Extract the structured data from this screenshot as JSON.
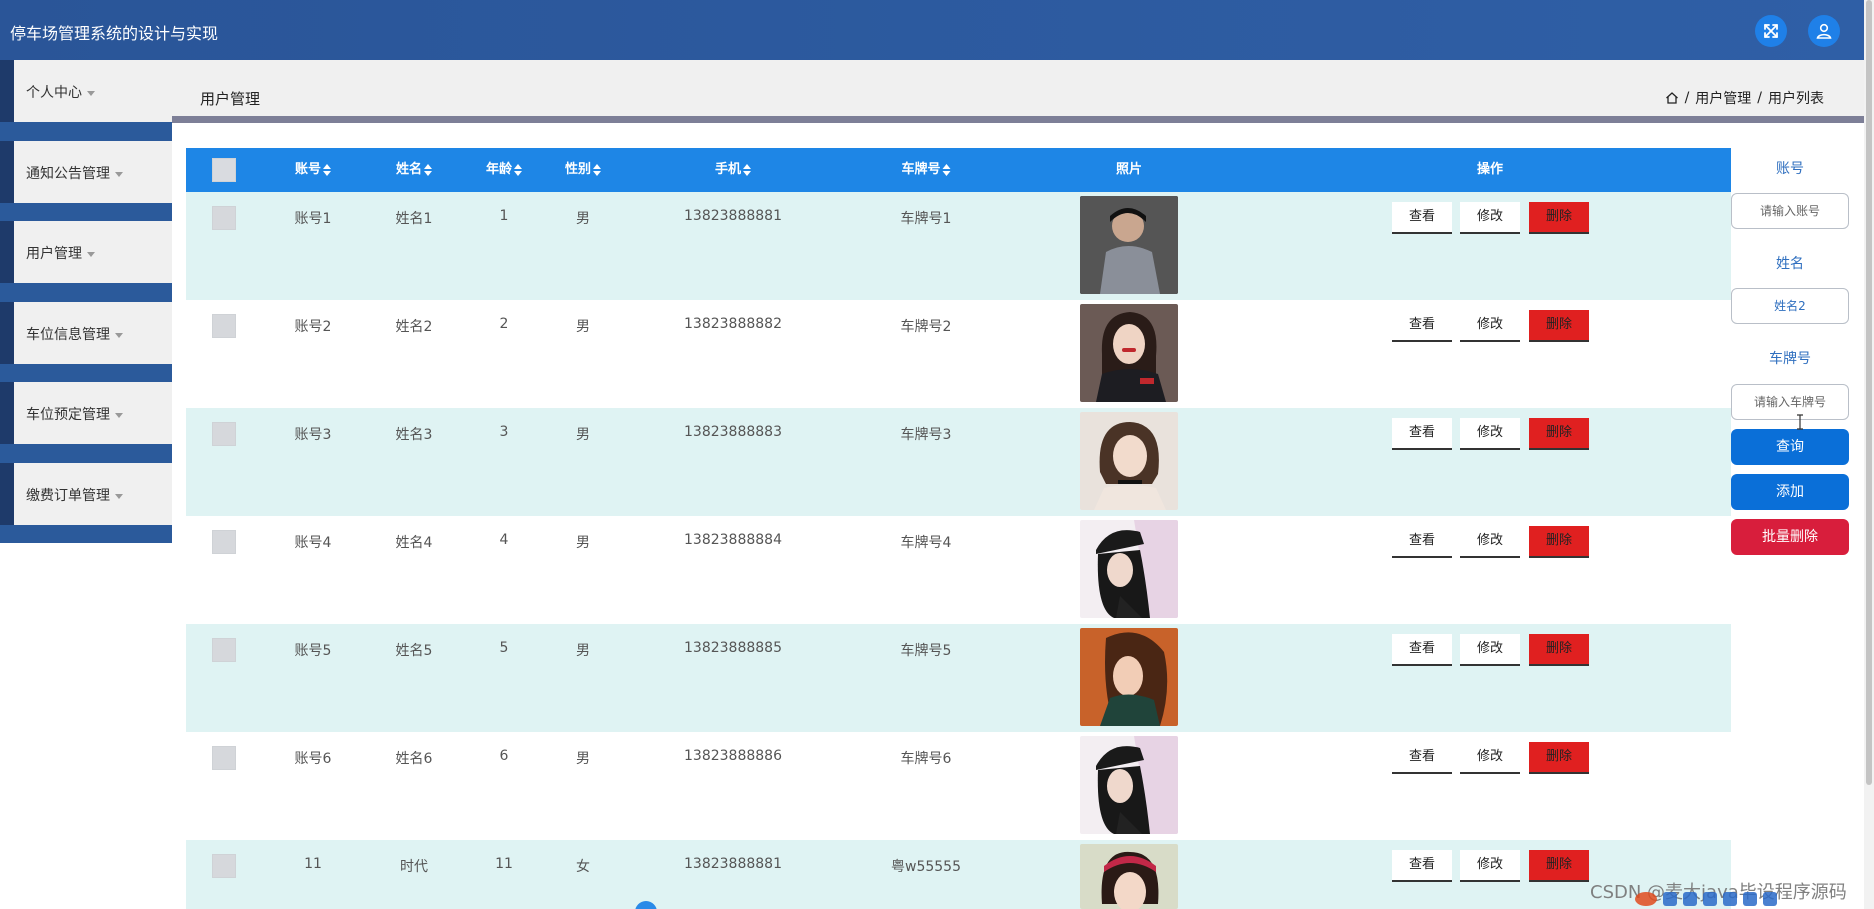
{
  "app": {
    "title": "停车场管理系统的设计与实现"
  },
  "header": {
    "fullscreen_icon": "expand-arrows-icon",
    "user_icon": "user-icon"
  },
  "sidebar": {
    "items": [
      {
        "label": "个人中心"
      },
      {
        "label": "通知公告管理"
      },
      {
        "label": "用户管理"
      },
      {
        "label": "车位信息管理"
      },
      {
        "label": "车位预定管理"
      },
      {
        "label": "缴费订单管理"
      }
    ]
  },
  "page": {
    "title": "用户管理"
  },
  "breadcrumb": {
    "items": [
      "/",
      "用户管理",
      "/",
      "用户列表"
    ],
    "home_icon": "home-icon"
  },
  "table": {
    "columns": [
      "账号",
      "姓名",
      "年龄",
      "性别",
      "手机",
      "车牌号",
      "照片",
      "操作"
    ],
    "actions": {
      "view": "查看",
      "edit": "修改",
      "delete": "删除"
    },
    "rows": [
      {
        "account": "账号1",
        "name": "姓名1",
        "age": "1",
        "gender": "男",
        "phone": "13823888881",
        "plate": "车牌号1"
      },
      {
        "account": "账号2",
        "name": "姓名2",
        "age": "2",
        "gender": "男",
        "phone": "13823888882",
        "plate": "车牌号2"
      },
      {
        "account": "账号3",
        "name": "姓名3",
        "age": "3",
        "gender": "男",
        "phone": "13823888883",
        "plate": "车牌号3"
      },
      {
        "account": "账号4",
        "name": "姓名4",
        "age": "4",
        "gender": "男",
        "phone": "13823888884",
        "plate": "车牌号4"
      },
      {
        "account": "账号5",
        "name": "姓名5",
        "age": "5",
        "gender": "男",
        "phone": "13823888885",
        "plate": "车牌号5"
      },
      {
        "account": "账号6",
        "name": "姓名6",
        "age": "6",
        "gender": "男",
        "phone": "13823888886",
        "plate": "车牌号6"
      },
      {
        "account": "11",
        "name": "时代",
        "age": "11",
        "gender": "女",
        "phone": "13823888881",
        "plate": "粤w55555"
      }
    ]
  },
  "search": {
    "account_label": "账号",
    "account_placeholder": "请输入账号",
    "name_label": "姓名",
    "name_value": "姓名2",
    "plate_label": "车牌号",
    "plate_placeholder": "请输入车牌号",
    "query_button": "查询",
    "add_button": "添加",
    "batch_delete_button": "批量删除"
  },
  "watermark": "CSDN @麦大java毕设程序源码",
  "colors": {
    "topbar": "#2a5598",
    "table_header": "#1e86e6",
    "row_alt": "#dff3f3",
    "delete": "#e02020",
    "primary_button": "#0a6fd8",
    "danger_button": "#d81e3c"
  }
}
